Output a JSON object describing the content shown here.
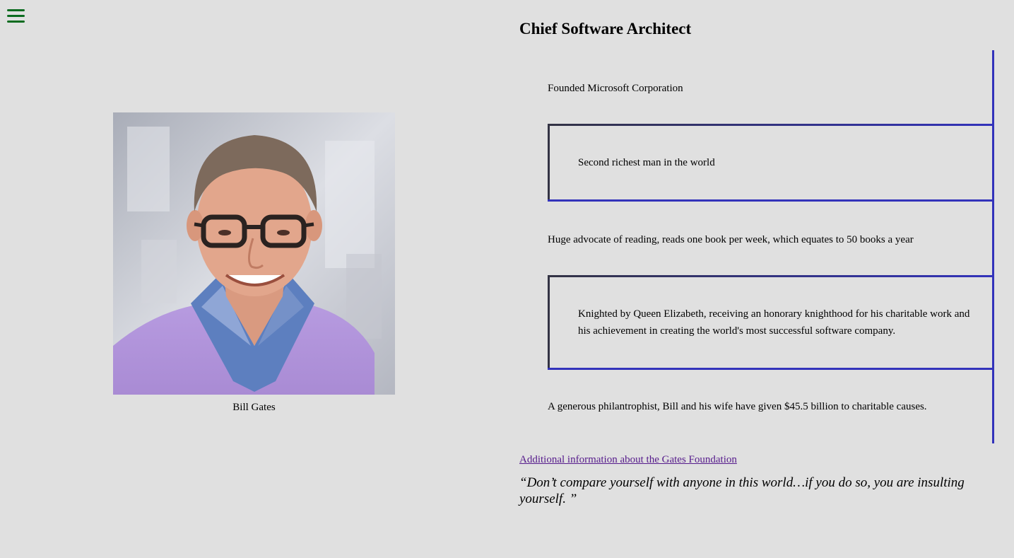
{
  "nav": {
    "menu_icon": "hamburger-menu-icon",
    "accent": "#0b6b1f"
  },
  "profile": {
    "caption": "Bill Gates"
  },
  "main": {
    "title": "Chief Software Architect",
    "timeline": [
      {
        "text": "Founded Microsoft Corporation"
      },
      {
        "text": "Second richest man in the world"
      },
      {
        "text": "Huge advocate of reading, reads one book per week, which equates to 50 books a year"
      },
      {
        "text": "Knighted by Queen Elizabeth, receiving an honorary knighthood for his charitable work and his achievement in creating the world's most successful software company."
      },
      {
        "text": "A generous philantrophist, Bill and his wife have given $45.5 billion to charitable causes."
      }
    ],
    "link_text": "Additional information about the Gates Foundation",
    "quote": "“Don’t compare yourself with anyone in this world…if you do so, you are insulting yourself. ”"
  },
  "colors": {
    "background": "#e0e0e0",
    "timeline_border": "#3333bb",
    "link": "#551a8b"
  }
}
